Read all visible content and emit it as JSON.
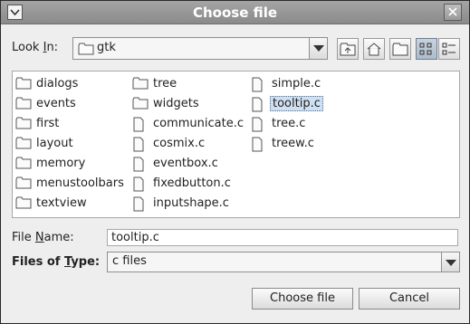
{
  "window": {
    "title": "Choose file"
  },
  "lookin": {
    "label_pre": "Look ",
    "label_mnemonic": "I",
    "label_post": "n:",
    "value": "gtk"
  },
  "toolbar": {
    "up_icon": "folder-up-icon",
    "home_icon": "home-icon",
    "newfolder_icon": "new-folder-icon",
    "list_icon": "list-view-icon",
    "details_icon": "details-view-icon"
  },
  "files": {
    "col1": [
      {
        "name": "dialogs",
        "type": "folder"
      },
      {
        "name": "events",
        "type": "folder"
      },
      {
        "name": "first",
        "type": "folder"
      },
      {
        "name": "layout",
        "type": "folder"
      },
      {
        "name": "memory",
        "type": "folder"
      },
      {
        "name": "menustoolbars",
        "type": "folder"
      },
      {
        "name": "textview",
        "type": "folder"
      }
    ],
    "col2": [
      {
        "name": "tree",
        "type": "folder"
      },
      {
        "name": "widgets",
        "type": "folder"
      },
      {
        "name": "communicate.c",
        "type": "file"
      },
      {
        "name": "cosmix.c",
        "type": "file"
      },
      {
        "name": "eventbox.c",
        "type": "file"
      },
      {
        "name": "fixedbutton.c",
        "type": "file"
      },
      {
        "name": "inputshape.c",
        "type": "file"
      }
    ],
    "col3": [
      {
        "name": "simple.c",
        "type": "file"
      },
      {
        "name": "tooltip.c",
        "type": "file",
        "selected": true
      },
      {
        "name": "tree.c",
        "type": "file"
      },
      {
        "name": "treew.c",
        "type": "file"
      }
    ]
  },
  "filename": {
    "label_pre": "File ",
    "label_mnemonic": "N",
    "label_post": "ame:",
    "value": "tooltip.c"
  },
  "filetype": {
    "label_pre": "Files of ",
    "label_mnemonic": "T",
    "label_post": "ype:",
    "value": "c files"
  },
  "buttons": {
    "choose": "Choose file",
    "cancel": "Cancel"
  }
}
